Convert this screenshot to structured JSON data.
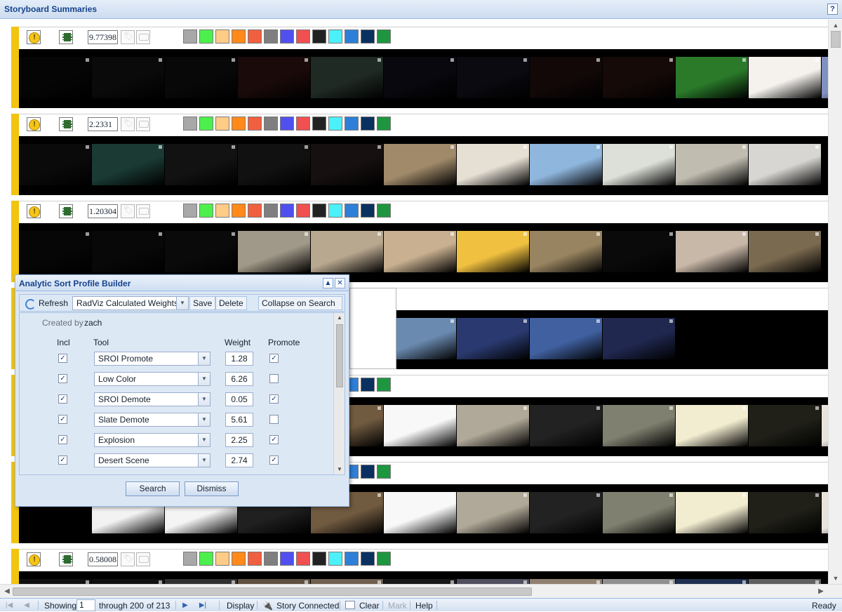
{
  "window": {
    "title": "Storyboard Summaries",
    "help_label": "?"
  },
  "colors": {
    "accent_bar": "#f1c40f",
    "swatches": [
      "#a8a8a8",
      "#4cf04c",
      "#ffcc88",
      "#ff8a1a",
      "#f06040",
      "#7f7f7f",
      "#5050f0",
      "#f05050",
      "#222222",
      "#4cf0f8",
      "#2e7fd8",
      "#0a3060",
      "#1e9640"
    ]
  },
  "stories": [
    {
      "score": "9.77398",
      "tones": [
        "#050505",
        "#0a0a0a",
        "#080808",
        "#1a0a0a",
        "#202a24",
        "#08080e",
        "#0a0a10",
        "#120808",
        "#150a08",
        "#2a7a2a",
        "#f5f2ee",
        "#8090c0"
      ]
    },
    {
      "score": "2.2331",
      "tones": [
        "#0a0a0a",
        "#1a3a33",
        "#121212",
        "#111111",
        "#161010",
        "#a08a6a",
        "#e6e0d4",
        "#8fb6dd",
        "#dce0d8",
        "#c0bcb0",
        "#d8d6d2"
      ]
    },
    {
      "score": "1.20304",
      "tones": [
        "#060606",
        "#080808",
        "#0a0a0a",
        "#a09888",
        "#b8a890",
        "#c8b090",
        "#f0c040",
        "#988460",
        "#0a0a0a",
        "#c8b8a8",
        "#7a6a50"
      ]
    },
    {
      "score": "",
      "tones": [
        "#1a2a55",
        "#c0d8f0",
        "#1a1a40",
        "#802030",
        "#203060",
        "#6a8ab0",
        "#2a3a70",
        "#4060a0",
        "#202850"
      ]
    },
    {
      "score": "",
      "tones": [
        "#000000",
        "#f2f2f2",
        "#f4f4f4",
        "#202020",
        "#705a40",
        "#f8f8f8",
        "#b0a898",
        "#222",
        "#808070",
        "#f2ecd0",
        "#202018",
        "#e8e4dc"
      ]
    },
    {
      "score": "0.58008",
      "tones": [
        "#101010",
        "#101010",
        "#303030",
        "#605040",
        "#706050",
        "#181818",
        "#505060",
        "#908070",
        "#909090",
        "#203050",
        "#606060"
      ]
    }
  ],
  "dialog": {
    "title": "Analytic Sort Profile Builder",
    "toolbar": {
      "refresh_label": "Refresh",
      "profile_value": "RadViz Calculated Weights",
      "save_label": "Save",
      "delete_label": "Delete",
      "collapse_label": "Collapse on Search"
    },
    "created_by_label": "Created by",
    "created_by_value": "zach",
    "columns": {
      "incl": "Incl",
      "tool": "Tool",
      "weight": "Weight",
      "promote": "Promote"
    },
    "rows": [
      {
        "incl": true,
        "tool": "SROI Promote",
        "weight": "1.28",
        "promote": true
      },
      {
        "incl": true,
        "tool": "Low Color",
        "weight": "6.26",
        "promote": false
      },
      {
        "incl": true,
        "tool": "SROI Demote",
        "weight": "0.05",
        "promote": true
      },
      {
        "incl": true,
        "tool": "Slate Demote",
        "weight": "5.61",
        "promote": false
      },
      {
        "incl": true,
        "tool": "Explosion",
        "weight": "2.25",
        "promote": true
      },
      {
        "incl": true,
        "tool": "Desert Scene",
        "weight": "2.74",
        "promote": true
      }
    ],
    "search_label": "Search",
    "dismiss_label": "Dismiss"
  },
  "paging": {
    "showing_label": "Showing",
    "page_value": "1",
    "through_label": "through 200",
    "of_label": "of 213",
    "display_label": "Display",
    "story_connected_label": "Story Connected",
    "clear_label": "Clear",
    "mark_label": "Mark",
    "help_label": "Help",
    "status": "Ready"
  }
}
